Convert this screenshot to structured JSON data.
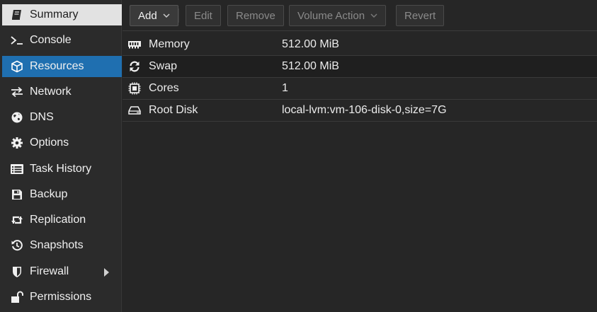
{
  "sidebar": {
    "items": [
      {
        "label": "Summary",
        "icon": "book-icon"
      },
      {
        "label": "Console",
        "icon": "terminal-icon"
      },
      {
        "label": "Resources",
        "icon": "cube-icon"
      },
      {
        "label": "Network",
        "icon": "exchange-icon"
      },
      {
        "label": "DNS",
        "icon": "globe-icon"
      },
      {
        "label": "Options",
        "icon": "gear-icon"
      },
      {
        "label": "Task History",
        "icon": "list-alt-icon"
      },
      {
        "label": "Backup",
        "icon": "floppy-icon"
      },
      {
        "label": "Replication",
        "icon": "retweet-icon"
      },
      {
        "label": "Snapshots",
        "icon": "history-icon"
      },
      {
        "label": "Firewall",
        "icon": "shield-icon"
      },
      {
        "label": "Permissions",
        "icon": "unlock-icon"
      }
    ],
    "selected": "Resources",
    "colors": {
      "selected_bg": "#1f6fb0",
      "summary_bg": "#e2e2e2"
    }
  },
  "toolbar": {
    "add_label": "Add",
    "edit_label": "Edit",
    "remove_label": "Remove",
    "volume_action_label": "Volume Action",
    "revert_label": "Revert"
  },
  "resources": {
    "rows": [
      {
        "name": "Memory",
        "value": "512.00 MiB",
        "icon": "memory-icon"
      },
      {
        "name": "Swap",
        "value": "512.00 MiB",
        "icon": "refresh-icon"
      },
      {
        "name": "Cores",
        "value": "1",
        "icon": "cpu-icon"
      },
      {
        "name": "Root Disk",
        "value": "local-lvm:vm-106-disk-0,size=7G",
        "icon": "hdd-icon"
      }
    ]
  }
}
